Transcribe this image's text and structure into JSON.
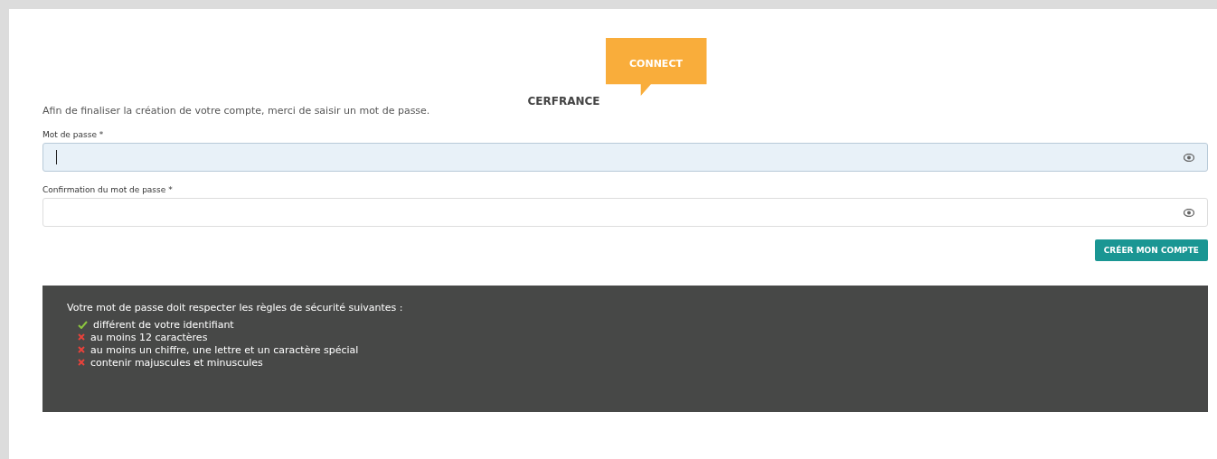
{
  "logo": {
    "badge": "CONNECT",
    "brand": "CERFRANCE"
  },
  "intro": "Afin de finaliser la création de votre compte, merci de saisir un mot de passe.",
  "fields": [
    {
      "label": "Mot de passe *",
      "focused": true
    },
    {
      "label": "Confirmation du mot de passe *",
      "focused": false
    }
  ],
  "submit": "CRÉER MON COMPTE",
  "rules": {
    "title": "Votre mot de passe doit respecter les règles de sécurité suivantes :",
    "items": [
      {
        "text": "différent de votre identifiant",
        "met": true
      },
      {
        "text": "au moins 12 caractères",
        "met": false
      },
      {
        "text": "au moins un chiffre, une lettre et un caractère spécial",
        "met": false
      },
      {
        "text": "contenir majuscules et minuscules",
        "met": false
      }
    ]
  }
}
